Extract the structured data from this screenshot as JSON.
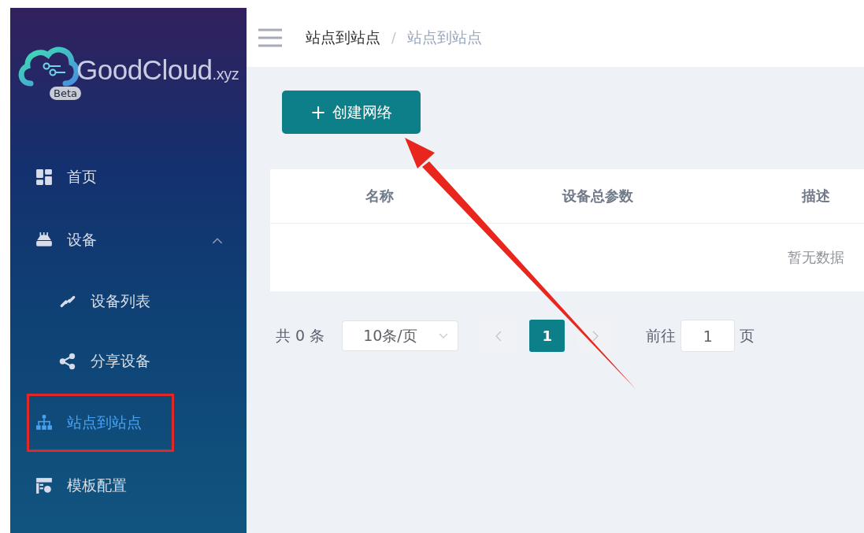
{
  "sidebar": {
    "logo": {
      "name": "GoodCloud",
      "suffix": ".xyz",
      "badge": "Beta"
    },
    "items": [
      {
        "label": "首页",
        "selected": false,
        "highlighted": false
      },
      {
        "label": "设备",
        "selected": false,
        "highlighted": false,
        "expanded": true,
        "children": [
          {
            "label": "设备列表",
            "selected": false,
            "highlighted": false
          },
          {
            "label": "分享设备",
            "selected": false,
            "highlighted": false
          }
        ]
      },
      {
        "label": "站点到站点",
        "selected": true,
        "highlighted": true
      },
      {
        "label": "模板配置",
        "selected": false,
        "highlighted": false
      }
    ]
  },
  "breadcrumb": [
    "站点到站点",
    "站点到站点"
  ],
  "breadcrumb_separator": "/",
  "create_button": {
    "icon": "+",
    "label": "创建网络"
  },
  "annotation_arrow": true,
  "table": {
    "columns": [
      "名称",
      "设备总参数",
      "描述"
    ],
    "empty_text": "暂无数据"
  },
  "pagination": {
    "total": "共 0 条",
    "page_size": "10条/页",
    "pages": [
      {
        "label": "1",
        "selected": true
      }
    ],
    "goto_label": "前往",
    "goto_value": "1",
    "goto_suffix": "页"
  }
}
